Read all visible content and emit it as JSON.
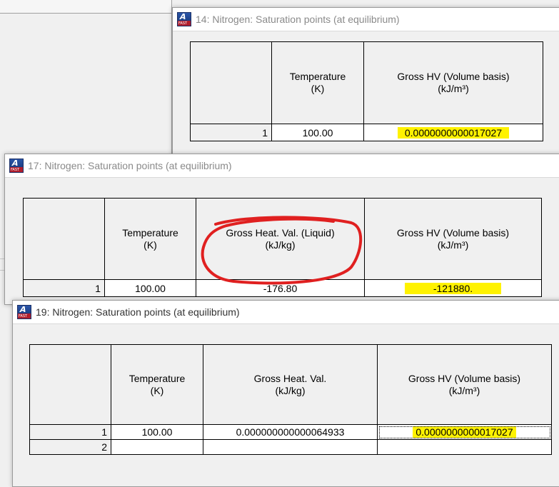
{
  "windows": [
    {
      "title": "14: Nitrogen: Saturation points (at equilibrium)",
      "columns": [
        {
          "label_line1": "Temperature",
          "label_line2": "(K)"
        },
        {
          "label_line1": "Gross HV (Volume basis)",
          "label_line2": "(kJ/m³)"
        }
      ],
      "rows": [
        {
          "num": "1",
          "cells": [
            "100.00",
            "0.0000000000017027"
          ]
        }
      ]
    },
    {
      "title": "17: Nitrogen: Saturation points (at equilibrium)",
      "columns": [
        {
          "label_line1": "Temperature",
          "label_line2": "(K)"
        },
        {
          "label_line1": "Gross Heat. Val. (Liquid)",
          "label_line2": "(kJ/kg)"
        },
        {
          "label_line1": "Gross HV (Volume basis)",
          "label_line2": "(kJ/m³)"
        }
      ],
      "rows": [
        {
          "num": "1",
          "cells": [
            "100.00",
            "-176.80",
            "-121880."
          ]
        }
      ]
    },
    {
      "title": "19: Nitrogen: Saturation points (at equilibrium)",
      "columns": [
        {
          "label_line1": "Temperature",
          "label_line2": "(K)"
        },
        {
          "label_line1": "Gross Heat. Val.",
          "label_line2": "(kJ/kg)"
        },
        {
          "label_line1": "Gross HV (Volume basis)",
          "label_line2": "(kJ/m³)"
        }
      ],
      "rows": [
        {
          "num": "1",
          "cells": [
            "100.00",
            "0.000000000000064933",
            "0.0000000000017027"
          ]
        },
        {
          "num": "2",
          "cells": [
            "",
            "",
            ""
          ]
        }
      ]
    }
  ],
  "colors": {
    "highlight": "#fff200",
    "annotation": "#e02020"
  },
  "icons": {
    "app": "refprop-app-icon"
  }
}
